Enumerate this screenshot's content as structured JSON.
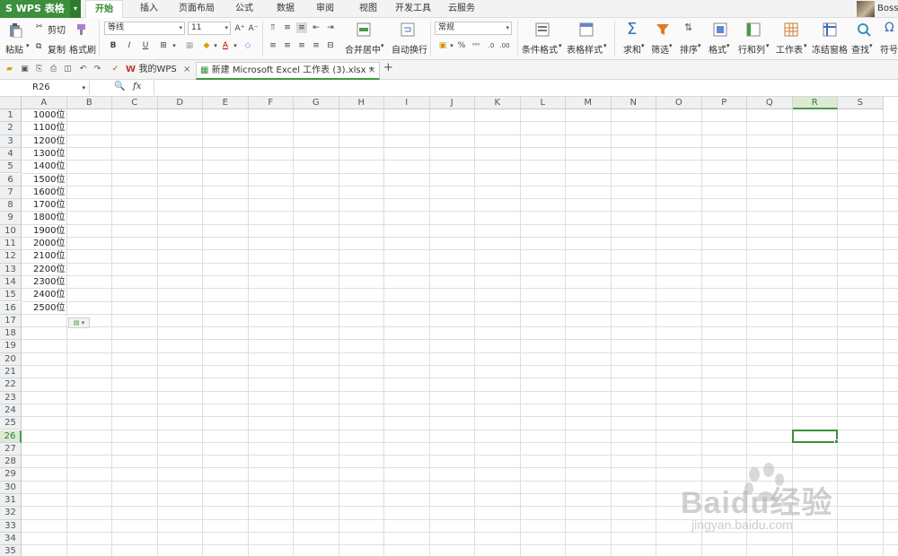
{
  "app": {
    "name": "WPS 表格",
    "user": "Bossa"
  },
  "menu_tabs": [
    "开始",
    "插入",
    "页面布局",
    "公式",
    "数据",
    "审阅",
    "视图",
    "开发工具",
    "云服务"
  ],
  "ribbon": {
    "paste": "粘贴",
    "cut": "剪切",
    "copy": "复制",
    "format_painter": "格式刷",
    "font_name": "等线",
    "font_size": "11",
    "merge_center": "合并居中",
    "wrap_text": "自动换行",
    "number_format": "常规",
    "conditional_format": "条件格式",
    "table_style": "表格样式",
    "sum": "求和",
    "filter": "筛选",
    "sort": "排序",
    "format": "格式",
    "row_col": "行和列",
    "worksheet": "工作表",
    "freeze": "冻结窗格",
    "find": "查找",
    "symbol": "符号"
  },
  "doc_tabs": {
    "home": "我的WPS",
    "current": "新建 Microsoft Excel 工作表 (3).xlsx *"
  },
  "formula_bar": {
    "name_box": "R26",
    "fx": "fx",
    "formula": ""
  },
  "columns": [
    "A",
    "B",
    "C",
    "D",
    "E",
    "F",
    "G",
    "H",
    "I",
    "J",
    "K",
    "L",
    "M",
    "N",
    "O",
    "P",
    "Q",
    "R",
    "S"
  ],
  "selected_column": "R",
  "selected_row": 26,
  "row_count": 35,
  "cells_a": [
    "1000位",
    "1100位",
    "1200位",
    "1300位",
    "1400位",
    "1500位",
    "1600位",
    "1700位",
    "1800位",
    "1900位",
    "2000位",
    "2100位",
    "2200位",
    "2300位",
    "2400位",
    "2500位"
  ],
  "watermark": {
    "text": "Baidu经验",
    "sub": "jingyan.baidu.com"
  }
}
